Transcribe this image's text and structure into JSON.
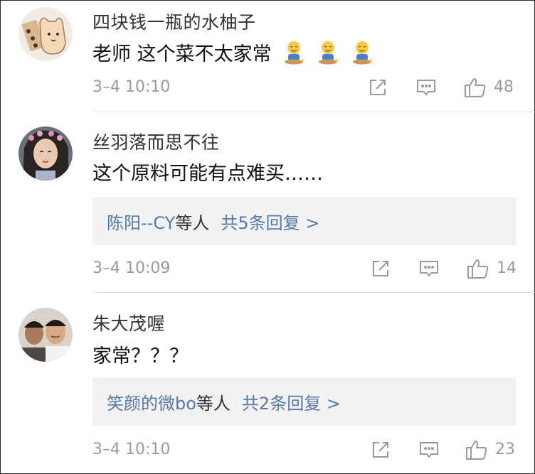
{
  "comments": [
    {
      "username": "四块钱一瓶的水柚子",
      "content": "老师 这个菜不太家常",
      "emoji_name": "meditating-emoji",
      "timestamp": "3–4 10:10",
      "likes": "48",
      "reply_preview": null
    },
    {
      "username": "丝羽落而思不往",
      "content": "这个原料可能有点难买……",
      "timestamp": "3–4 10:09",
      "likes": "14",
      "reply_preview": {
        "users": "陈阳--CY",
        "suffix": "等人",
        "more": "共5条回复 >"
      }
    },
    {
      "username": "朱大茂喔",
      "content": "家常？？？",
      "timestamp": "3–4 10:10",
      "likes": "23",
      "reply_preview": {
        "users": "笑颜的微bo",
        "suffix": "等人",
        "more": "共2条回复 >"
      }
    }
  ],
  "icons": {
    "share": "share-icon",
    "comment": "comment-icon",
    "like": "thumbs-up-icon"
  },
  "colors": {
    "link": "#557aa6",
    "meta": "#9a9a9a",
    "reply_bg": "#f2f2f2"
  }
}
